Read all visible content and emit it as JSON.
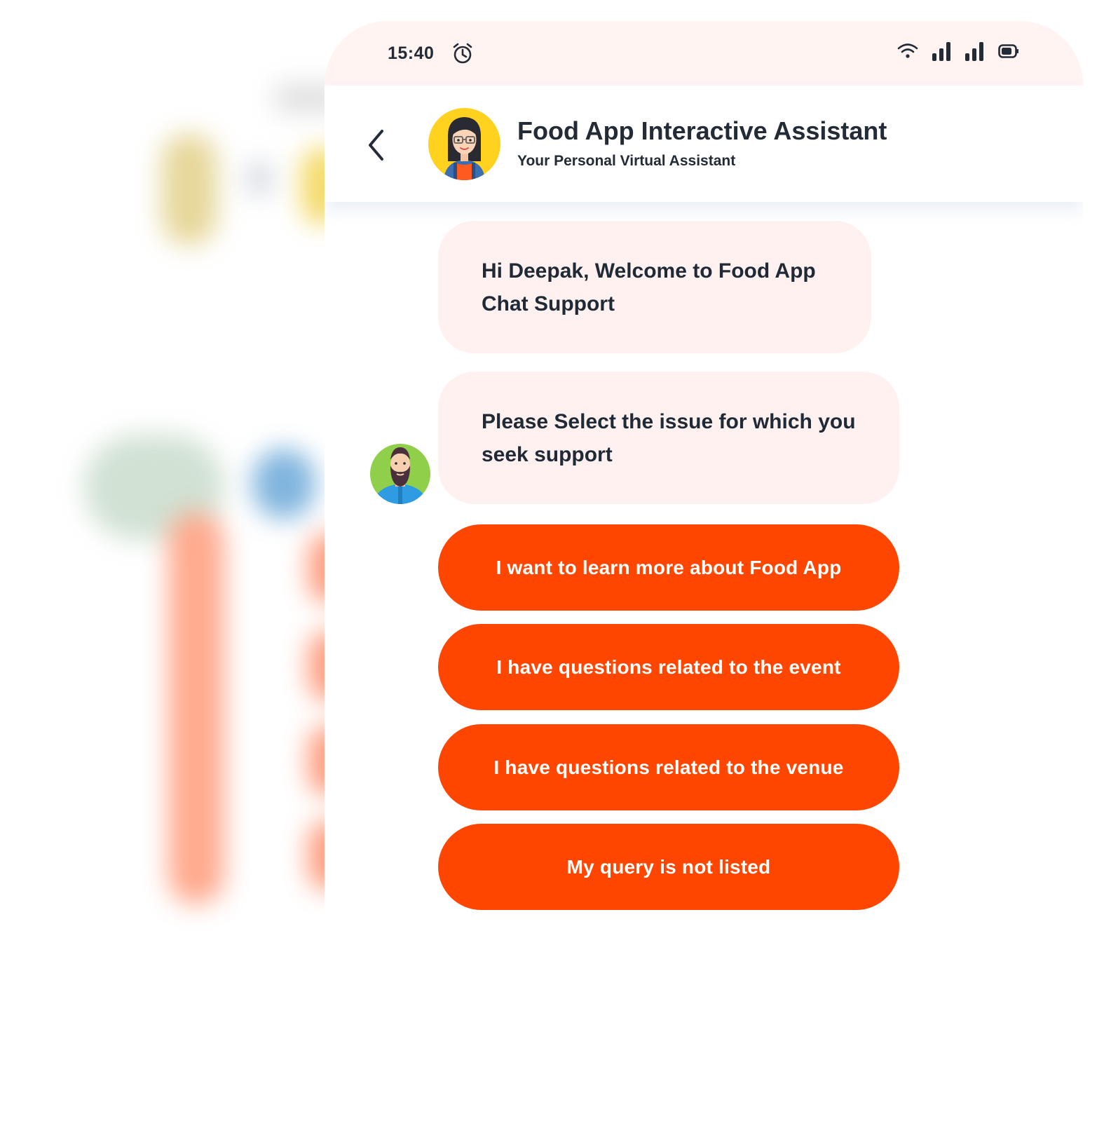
{
  "status_bar": {
    "time": "15:40",
    "icons": [
      "alarm-icon",
      "wifi-icon",
      "signal-icon",
      "signal-icon",
      "battery-icon"
    ]
  },
  "header": {
    "back_icon": "chevron-left-icon",
    "avatar": "assistant-avatar",
    "title": "Food App Interactive Assistant",
    "subtitle": "Your Personal Virtual Assistant"
  },
  "chat": {
    "messages": [
      {
        "text": "Hi Deepak, Welcome to Food App Chat Support"
      },
      {
        "text": "Please Select the issue for which you seek support"
      }
    ],
    "options": [
      {
        "label": "I want to learn more about Food App"
      },
      {
        "label": "I have questions related to the event"
      },
      {
        "label": "I have questions related to the venue"
      },
      {
        "label": "My query is not listed"
      }
    ]
  },
  "colors": {
    "accent": "#ff4600",
    "bubble_bg": "#fff1ef",
    "status_bar_bg": "#fff4f2",
    "text_dark": "#222b36"
  }
}
